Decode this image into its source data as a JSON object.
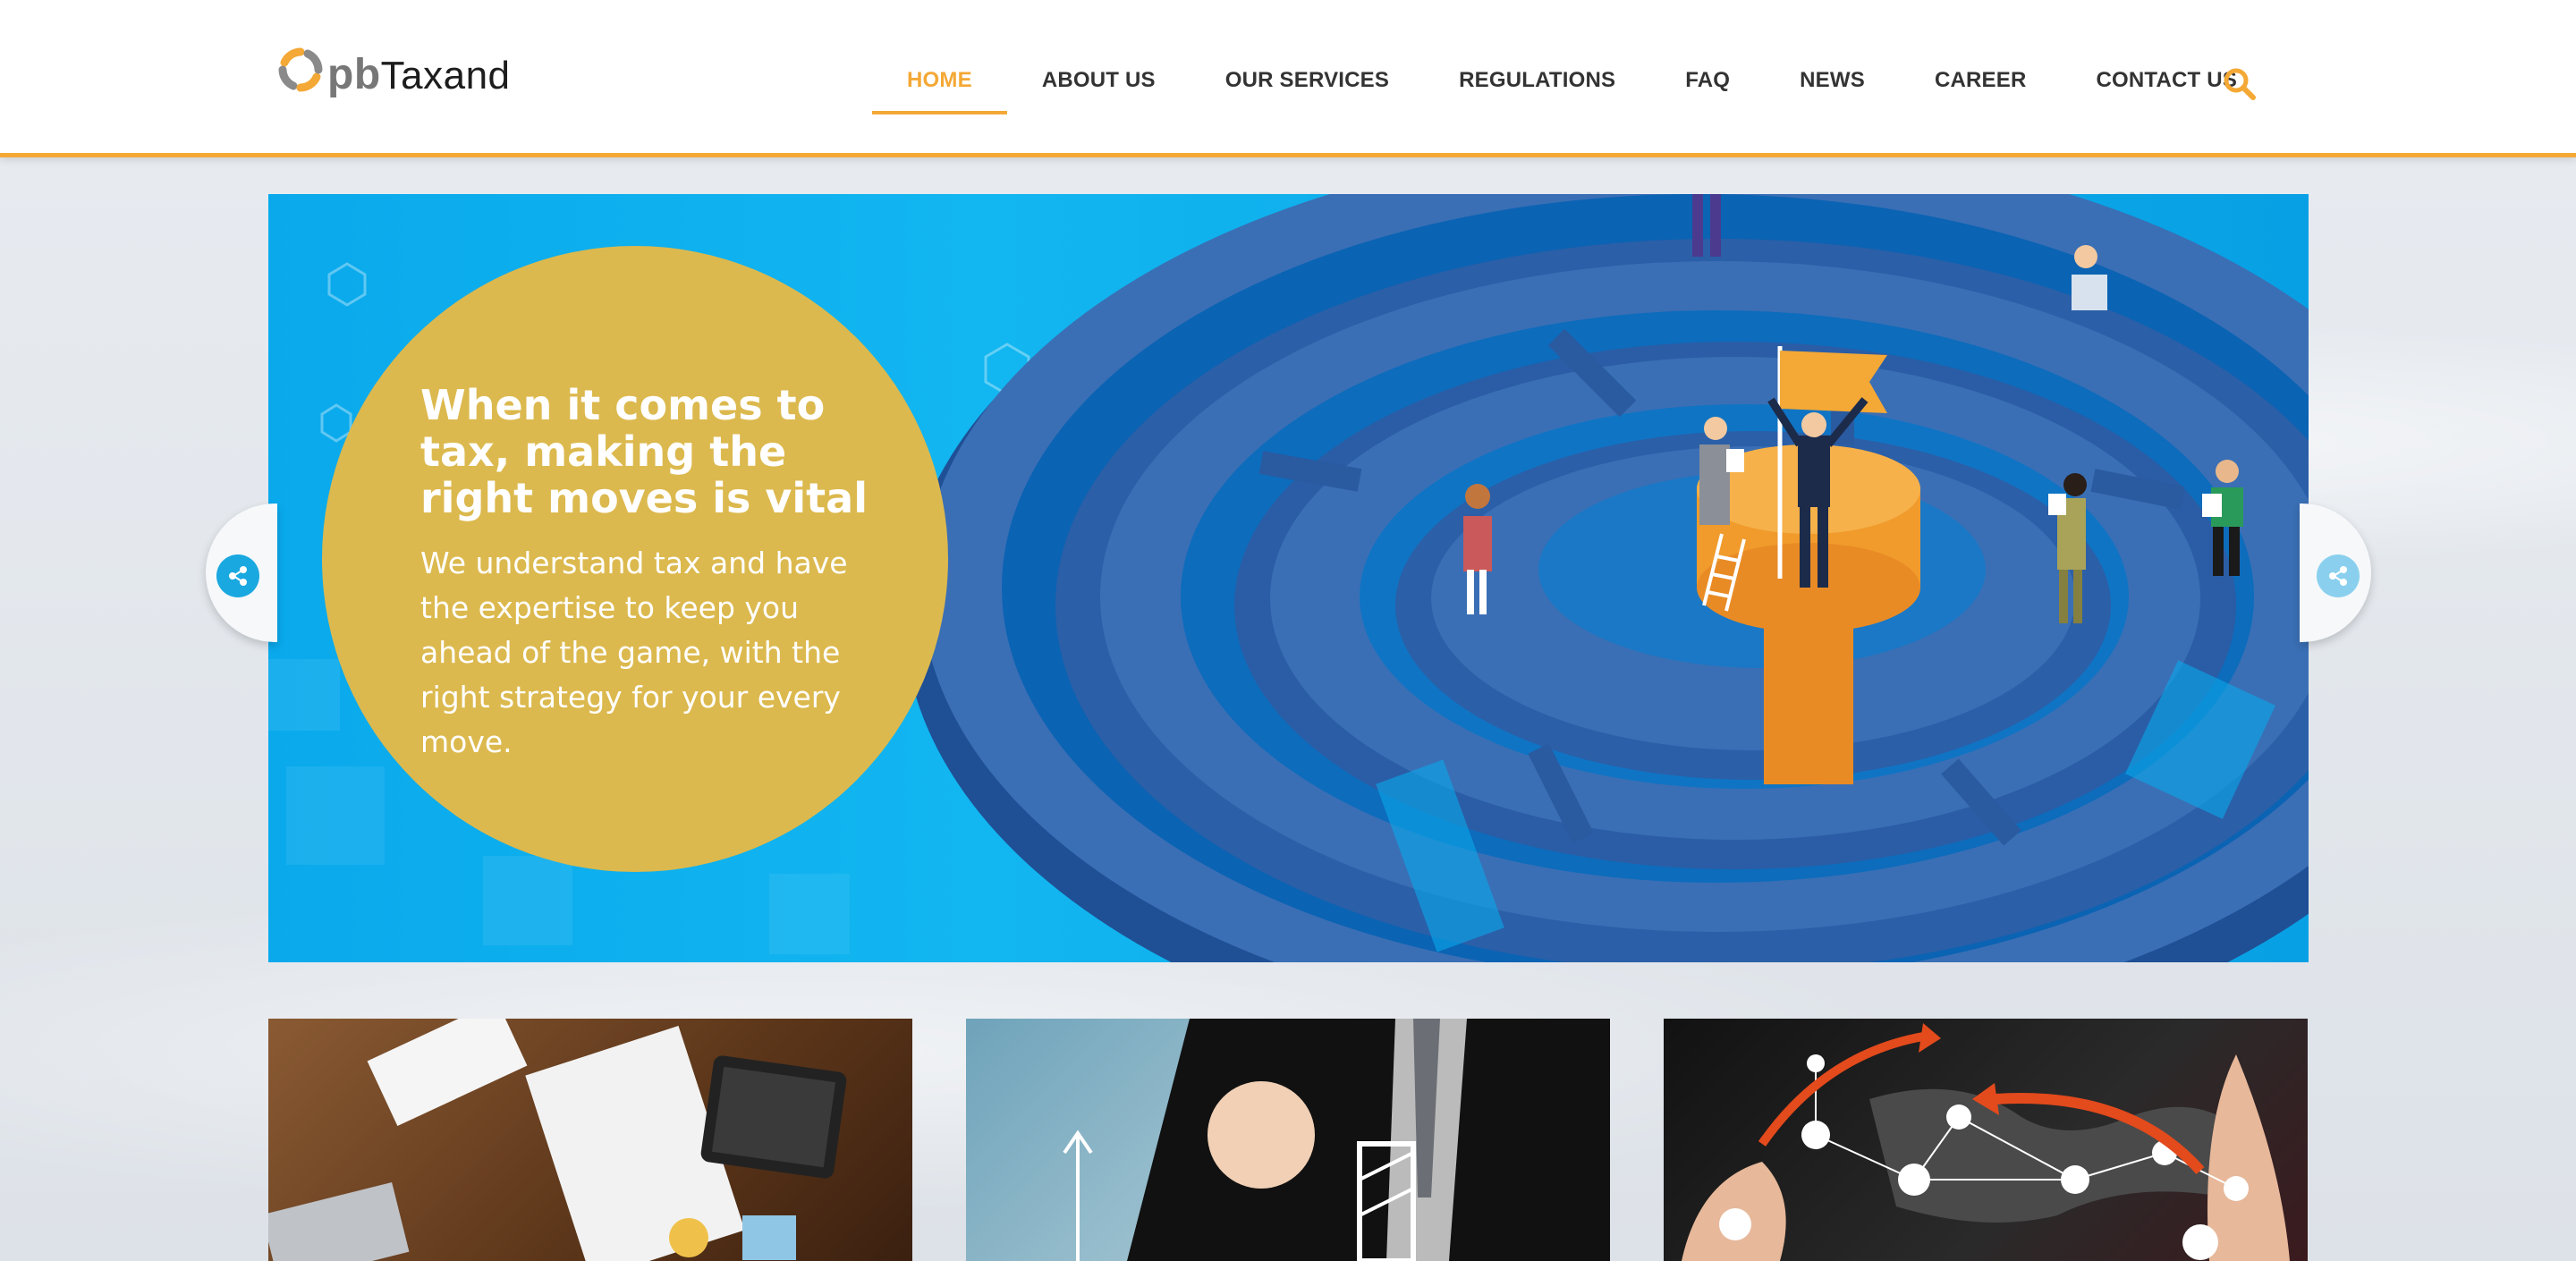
{
  "logo": {
    "prefix": "pb",
    "name": "Taxand"
  },
  "nav": {
    "items": [
      {
        "label": "HOME",
        "active": true
      },
      {
        "label": "ABOUT US",
        "active": false
      },
      {
        "label": "OUR SERVICES",
        "active": false
      },
      {
        "label": "REGULATIONS",
        "active": false
      },
      {
        "label": "FAQ",
        "active": false
      },
      {
        "label": "NEWS",
        "active": false
      },
      {
        "label": "CAREER",
        "active": false
      },
      {
        "label": "CONTACT US",
        "active": false
      }
    ],
    "search_icon": "search-icon"
  },
  "hero": {
    "title": "When it comes to tax, making the right moves is vital",
    "description": "We understand tax and have the expertise to keep you ahead of the game, with the right strategy for your every move."
  },
  "side_buttons": {
    "left_icon": "share-icon",
    "right_icon": "share-icon"
  },
  "colors": {
    "accent": "#f4a835",
    "hero_blue": "#12b6f0",
    "maze_blue": "#3a6fb5",
    "circle_gold": "#dcb94e",
    "share_blue": "#1aa8e0"
  }
}
